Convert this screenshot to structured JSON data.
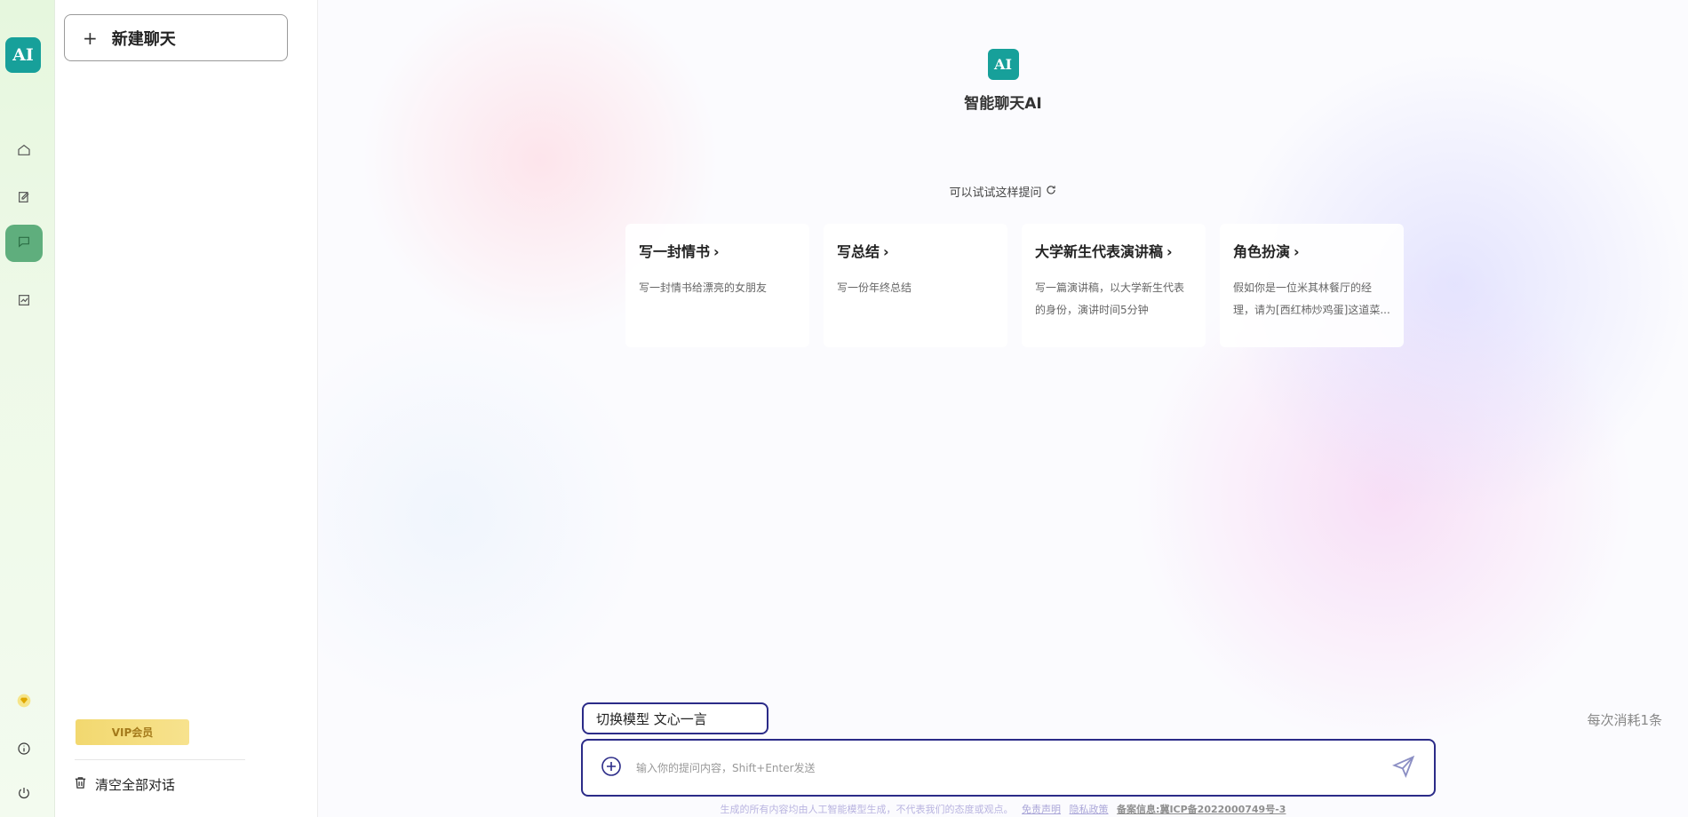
{
  "rail": {
    "logo_text": "AI",
    "icons": [
      "home-icon",
      "edit-icon",
      "chat-icon",
      "chart-icon"
    ],
    "active": "chat-icon",
    "bottom_icons": [
      "vip-diamond-icon",
      "info-icon",
      "power-icon"
    ]
  },
  "sidebar": {
    "new_chat_label": "新建聊天",
    "vip_label": "VIP会员",
    "clear_all_label": "清空全部对话"
  },
  "main": {
    "app_title": "智能聊天AI",
    "try_hint": "可以试试这样提问",
    "cards": [
      {
        "title": "写一封情书",
        "desc": "写一封情书给漂亮的女朋友"
      },
      {
        "title": "写总结",
        "desc": "写一份年终总结"
      },
      {
        "title": "大学新生代表演讲稿",
        "desc": "写一篇演讲稿，以大学新生代表的身份，演讲时间5分钟"
      },
      {
        "title": "角色扮演",
        "desc": "假如你是一位米其林餐厅的经理，请为[西红柿炒鸡蛋]这道菜..."
      }
    ],
    "model_switch": "切换模型 文心一言",
    "cost_label": "每次消耗1条",
    "input_placeholder": "输入你的提问内容，Shift+Enter发送",
    "footer": {
      "disclaimer": "生成的所有内容均由人工智能模型生成，不代表我们的态度或观点。",
      "link_terms": "免责声明",
      "link_privacy": "隐私政策",
      "icp": "备案信息:冀ICP备2022000749号-3"
    }
  },
  "colors": {
    "accent_border": "#2b2b88",
    "logo_teal": "#17a09a",
    "active_green": "#5fae7d",
    "vip_gold": "#f2d86f"
  }
}
